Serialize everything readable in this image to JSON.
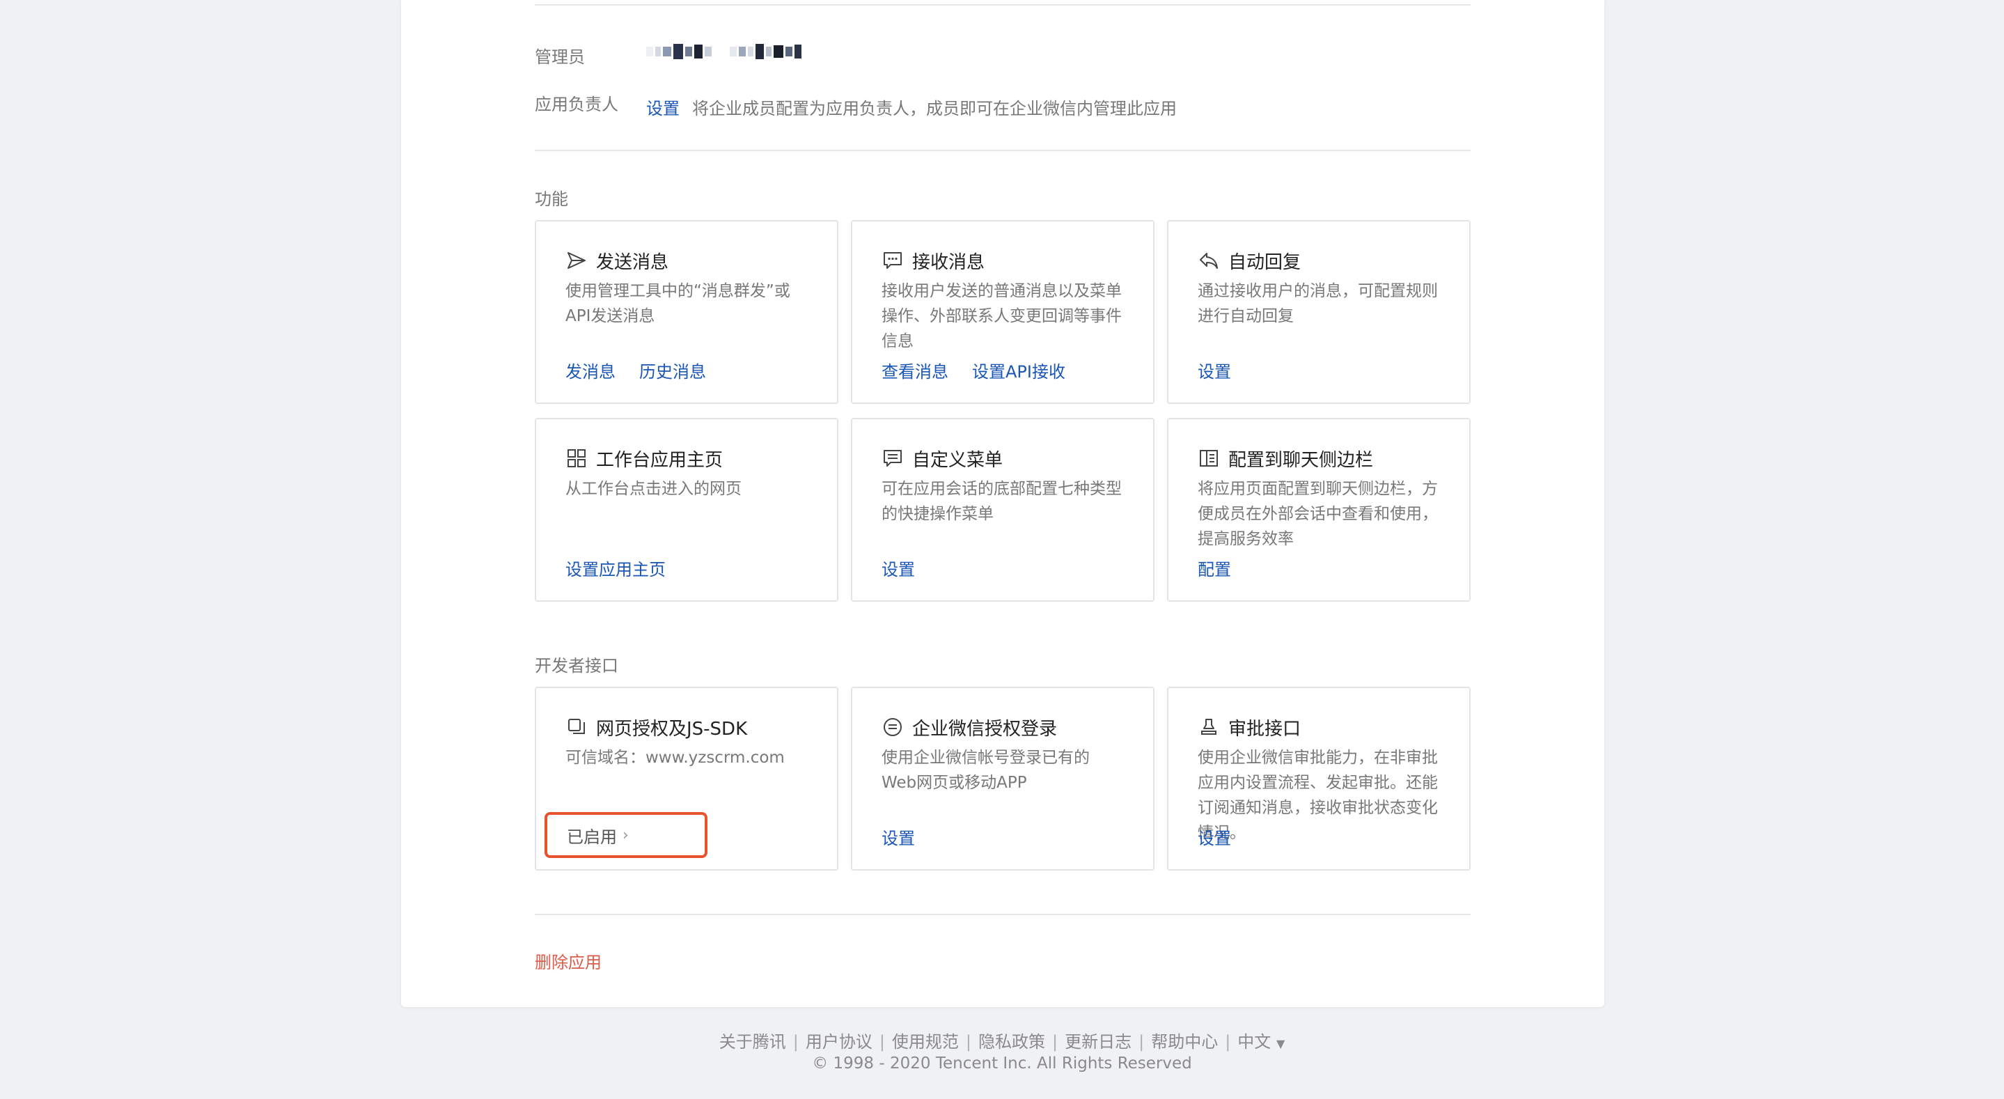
{
  "admin": {
    "label": "管理员"
  },
  "owner": {
    "label": "应用负责人",
    "set_link": "设置",
    "description": "将企业成员配置为应用负责人，成员即可在企业微信内管理此应用"
  },
  "features": {
    "title": "功能",
    "cards": [
      {
        "icon": "send-icon",
        "title": "发送消息",
        "desc": "使用管理工具中的“消息群发”或API发送消息",
        "links": [
          "发消息",
          "历史消息"
        ]
      },
      {
        "icon": "chat-bubble-icon",
        "title": "接收消息",
        "desc": "接收用户发送的普通消息以及菜单操作、外部联系人变更回调等事件信息",
        "links": [
          "查看消息",
          "设置API接收"
        ]
      },
      {
        "icon": "reply-icon",
        "title": "自动回复",
        "desc": "通过接收用户的消息，可配置规则进行自动回复",
        "links": [
          "设置"
        ]
      },
      {
        "icon": "grid-icon",
        "title": "工作台应用主页",
        "desc": "从工作台点击进入的网页",
        "links": [
          "设置应用主页"
        ]
      },
      {
        "icon": "menu-icon",
        "title": "自定义菜单",
        "desc": "可在应用会话的底部配置七种类型的快捷操作菜单",
        "links": [
          "设置"
        ]
      },
      {
        "icon": "sidebar-icon",
        "title": "配置到聊天侧边栏",
        "desc": "将应用页面配置到聊天侧边栏，方便成员在外部会话中查看和使用，提高服务效率",
        "links": [
          "配置"
        ]
      }
    ]
  },
  "developer": {
    "title": "开发者接口",
    "cards": [
      {
        "icon": "copy-icon",
        "title": "网页授权及JS-SDK",
        "desc": "可信域名：www.yzscrm.com",
        "status": "已启用"
      },
      {
        "icon": "login-icon",
        "title": "企业微信授权登录",
        "desc": "使用企业微信帐号登录已有的Web网页或移动APP",
        "links": [
          "设置"
        ]
      },
      {
        "icon": "stamp-icon",
        "title": "审批接口",
        "desc": "使用企业微信审批能力，在非审批应用内设置流程、发起审批。还能订阅通知消息，接收审批状态变化情况。",
        "links": [
          "设置"
        ]
      }
    ]
  },
  "delete_app": "删除应用",
  "footer": {
    "links": [
      "关于腾讯",
      "用户协议",
      "使用规范",
      "隐私政策",
      "更新日志",
      "帮助中心"
    ],
    "language": "中文",
    "language_caret": "▼",
    "copyright": "© 1998 - 2020 Tencent Inc. All Rights Reserved"
  },
  "colors": {
    "link": "#1a56b5",
    "danger": "#e05a4a",
    "highlight_box": "#e8532f",
    "muted_text": "#787878",
    "background": "#f0f1f4"
  }
}
